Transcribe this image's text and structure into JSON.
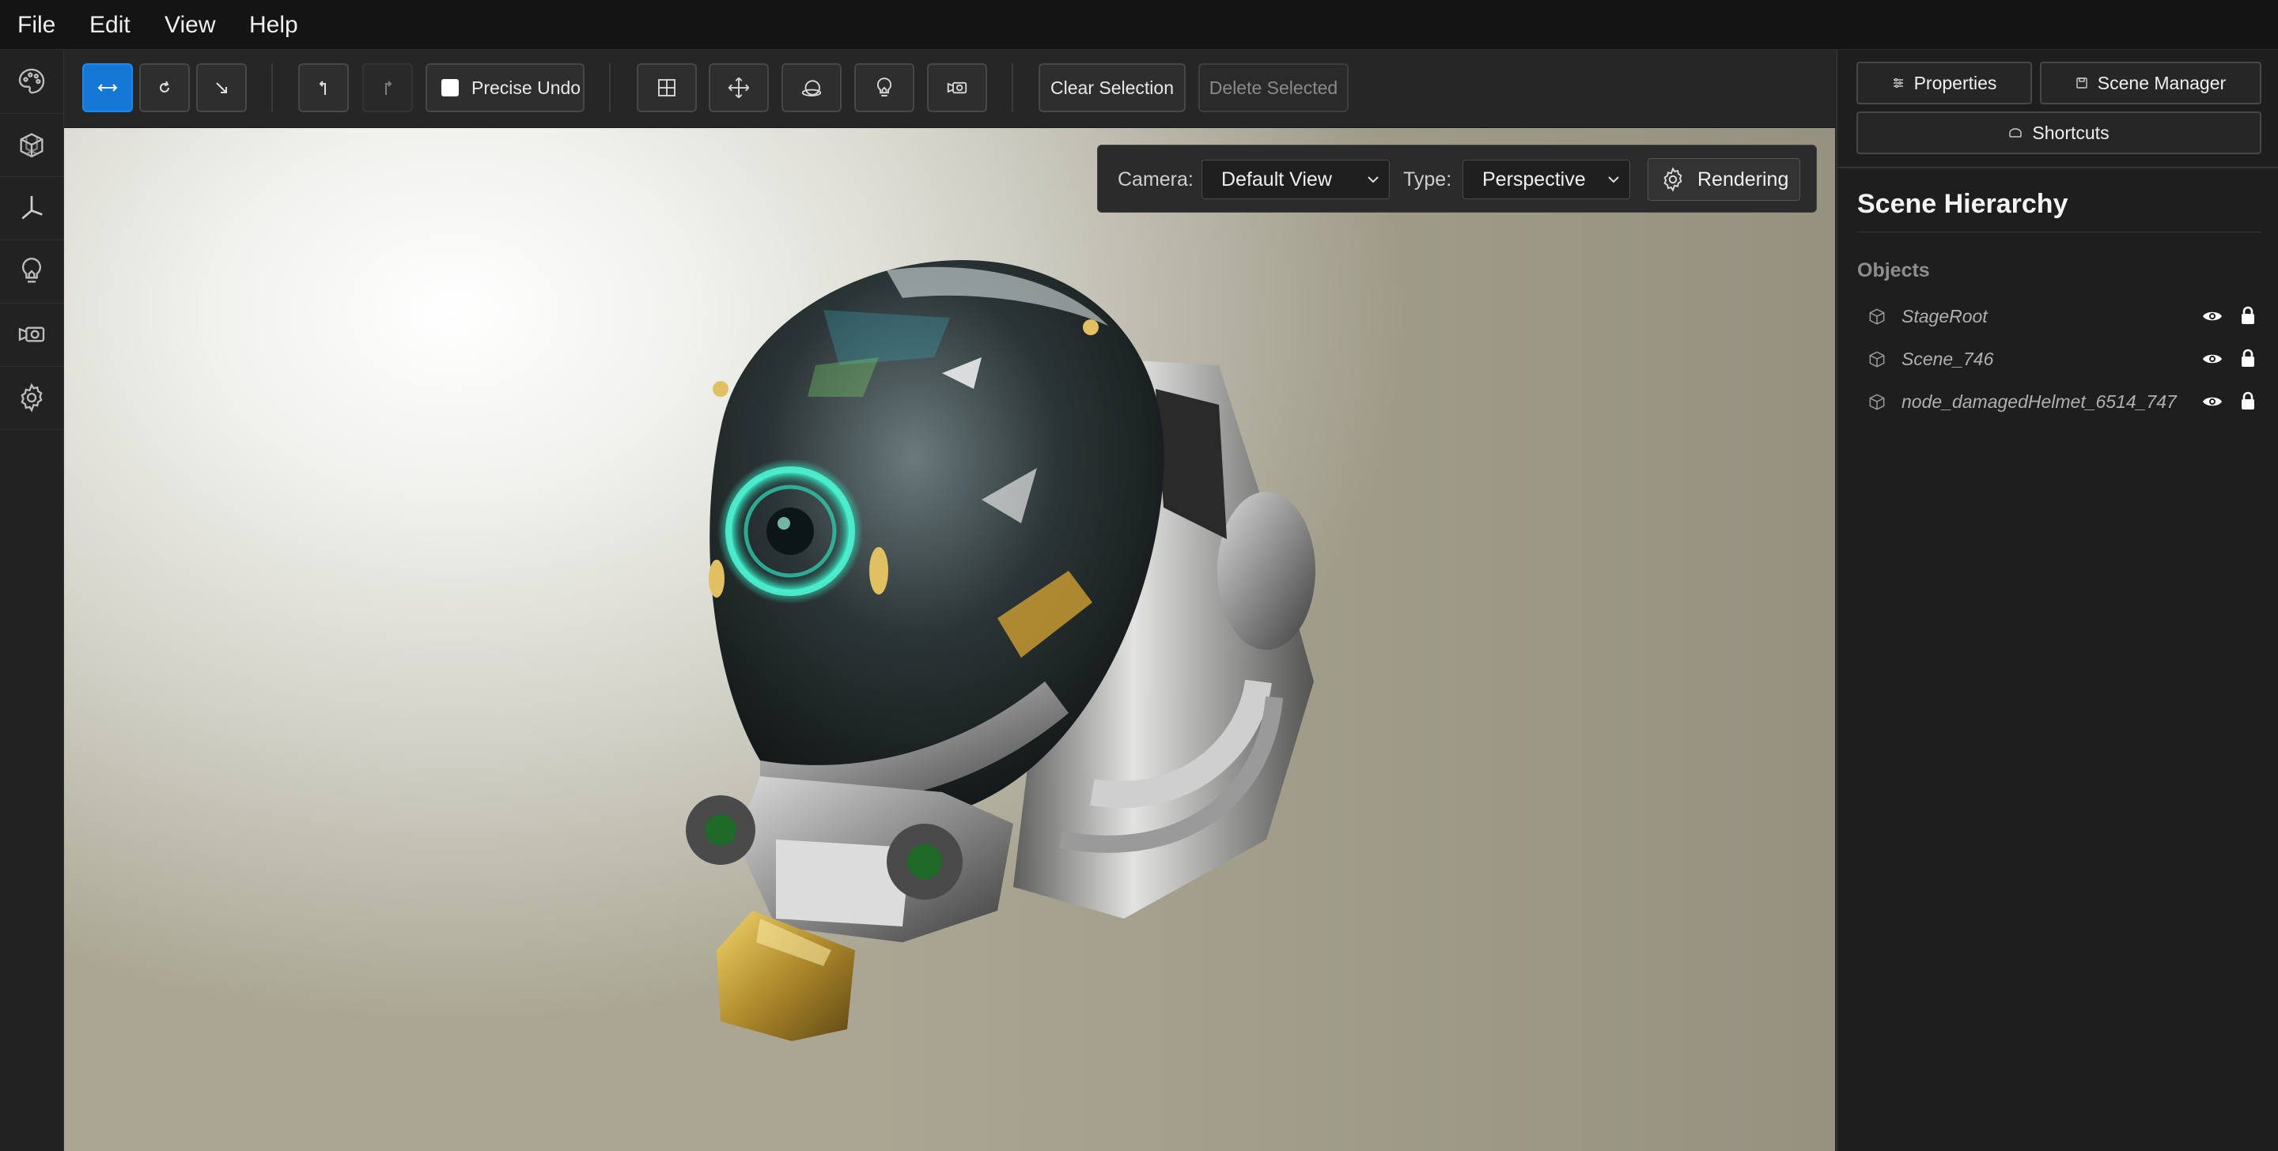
{
  "menu": {
    "file": "File",
    "edit": "Edit",
    "view": "View",
    "help": "Help"
  },
  "left_sidebar": {
    "icons": [
      "palette-icon",
      "cube-wireframe-icon",
      "axis-icon",
      "lightbulb-icon",
      "camera-icon",
      "gear-icon"
    ]
  },
  "toolbar": {
    "transform_modes": [
      "translate-icon",
      "rotate-icon",
      "scale-icon"
    ],
    "active_mode": "translate",
    "undo_icon": "undo-icon",
    "redo_icon": "redo-icon",
    "precise_undo_label": "Precise Undo",
    "precise_undo_checked": false,
    "add_tools": [
      "grid-icon",
      "move-icon",
      "material-sphere-icon",
      "light-icon",
      "camera-icon"
    ],
    "clear_selection_label": "Clear Selection",
    "delete_selected_label": "Delete Selected"
  },
  "camera_panel": {
    "camera_label": "Camera:",
    "camera_value": "Default View",
    "type_label": "Type:",
    "type_value": "Perspective",
    "rendering_label": "Rendering"
  },
  "right_panel": {
    "properties_label": "Properties",
    "scene_manager_label": "Scene Manager",
    "shortcuts_label": "Shortcuts",
    "scene_hierarchy_title": "Scene Hierarchy",
    "objects_label": "Objects",
    "objects": [
      {
        "name": "StageRoot"
      },
      {
        "name": "Scene_746"
      },
      {
        "name": "node_damagedHelmet_6514_747"
      }
    ]
  },
  "colors": {
    "accent": "#1577d6",
    "panel_bg": "#1e1e1e",
    "toolbar_bg": "#262626",
    "menubar_bg": "#141414"
  }
}
